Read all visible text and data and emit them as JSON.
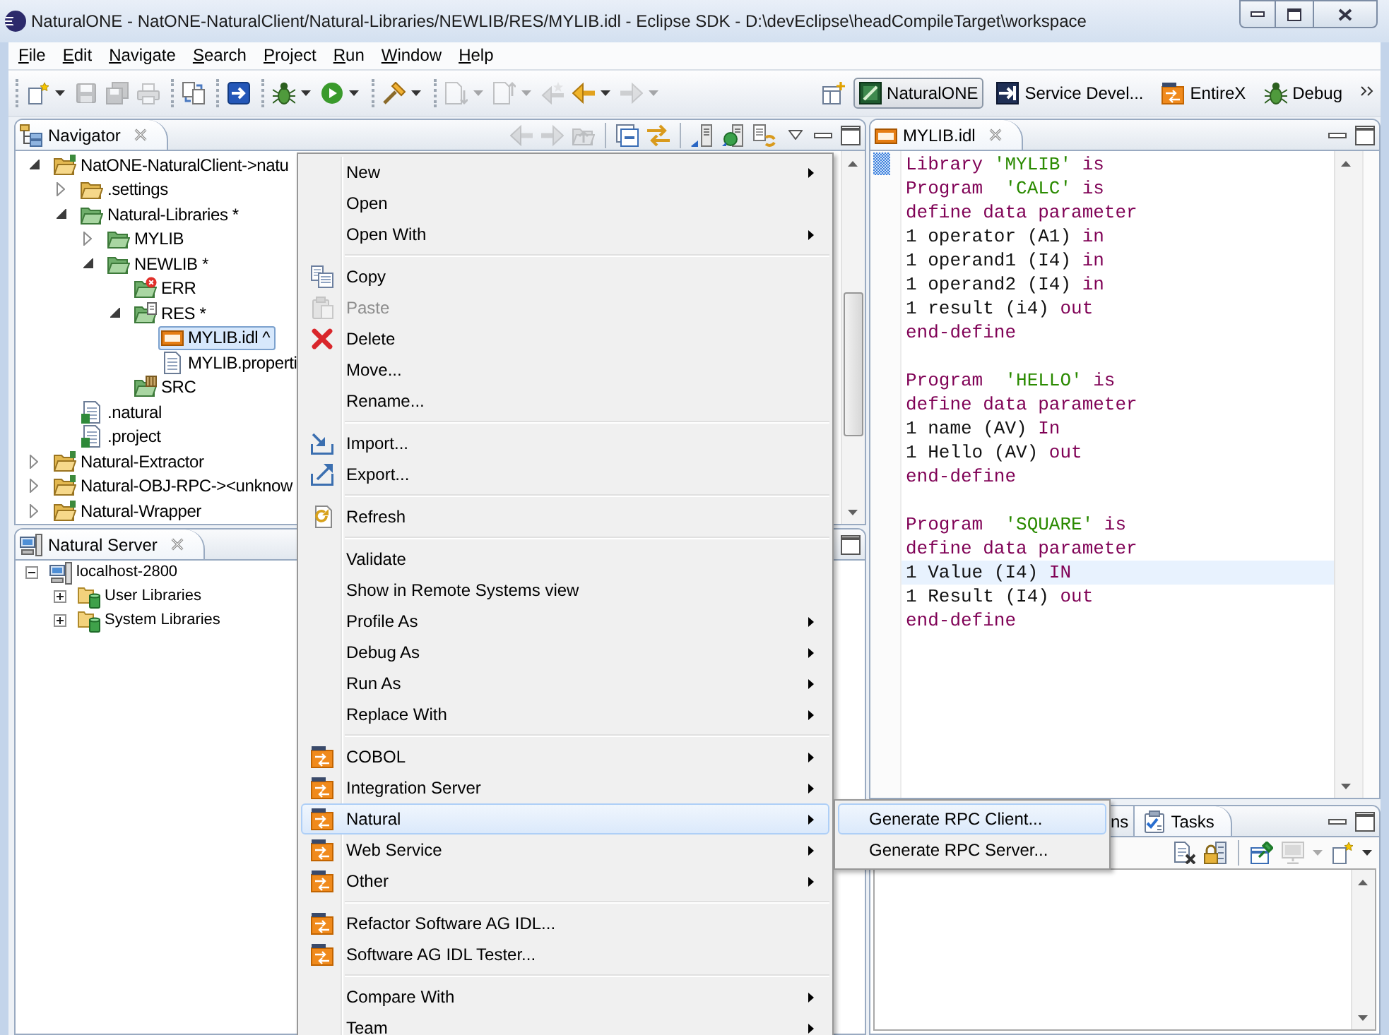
{
  "window": {
    "title": "NaturalONE - NatONE-NaturalClient/Natural-Libraries/NEWLIB/RES/MYLIB.idl - Eclipse SDK - D:\\devEclipse\\headCompileTarget\\workspace"
  },
  "menu_bar": [
    "File",
    "Edit",
    "Navigate",
    "Search",
    "Project",
    "Run",
    "Window",
    "Help"
  ],
  "toolbar": [
    [
      {
        "kind": "new",
        "dropdown": true,
        "disabled": false
      },
      {
        "kind": "save",
        "dropdown": false,
        "disabled": true
      },
      {
        "kind": "saveall",
        "dropdown": false,
        "disabled": true
      },
      {
        "kind": "print",
        "dropdown": false,
        "disabled": true
      }
    ],
    [
      {
        "kind": "sync",
        "dropdown": false,
        "disabled": false
      }
    ],
    [
      {
        "kind": "launch",
        "dropdown": false,
        "disabled": false
      }
    ],
    [
      {
        "kind": "debug",
        "dropdown": true,
        "disabled": false
      },
      {
        "kind": "run",
        "dropdown": true,
        "disabled": false
      }
    ],
    [
      {
        "kind": "tools",
        "dropdown": true,
        "disabled": false
      }
    ],
    [
      {
        "kind": "next",
        "dropdown": true,
        "disabled": true
      },
      {
        "kind": "prev",
        "dropdown": true,
        "disabled": true
      },
      {
        "kind": "lastedit",
        "dropdown": false,
        "disabled": true
      },
      {
        "kind": "back",
        "dropdown": true,
        "disabled": false
      },
      {
        "kind": "forward",
        "dropdown": true,
        "disabled": true
      }
    ]
  ],
  "perspectives": [
    {
      "kind": "natural",
      "label": "NaturalONE",
      "selected": true
    },
    {
      "kind": "service",
      "label": "Service Devel...",
      "selected": false
    },
    {
      "kind": "entirex",
      "label": "EntireX",
      "selected": false
    },
    {
      "kind": "debug",
      "label": "Debug",
      "selected": false
    }
  ],
  "navigator": {
    "title": "Navigator",
    "toolbar": [
      {
        "kind": "back",
        "disabled": true
      },
      {
        "kind": "forward",
        "disabled": true
      },
      {
        "kind": "up",
        "disabled": true
      },
      {
        "kind": "separator"
      },
      {
        "kind": "collapse",
        "disabled": false
      },
      {
        "kind": "link",
        "disabled": false
      },
      {
        "kind": "separator"
      },
      {
        "kind": "upload",
        "disabled": false
      },
      {
        "kind": "download",
        "disabled": false
      },
      {
        "kind": "syncserver",
        "disabled": false
      }
    ],
    "tree": [
      {
        "label": "NatONE-NaturalClient->natu",
        "kind": "project",
        "expanded": true,
        "selected": false,
        "children": [
          {
            "label": ".settings",
            "kind": "folder",
            "expanded": false,
            "selected": false
          },
          {
            "label": "Natural-Libraries *",
            "kind": "libfolder",
            "expanded": true,
            "selected": false,
            "children": [
              {
                "label": "MYLIB",
                "kind": "libfolder",
                "expanded": false,
                "selected": false
              },
              {
                "label": "NEWLIB *",
                "kind": "libfolder",
                "expanded": true,
                "selected": false,
                "children": [
                  {
                    "label": "ERR",
                    "kind": "errfolder",
                    "selected": false
                  },
                  {
                    "label": "RES *",
                    "kind": "resfolder",
                    "expanded": true,
                    "selected": false,
                    "children": [
                      {
                        "label": "MYLIB.idl ^",
                        "kind": "idl",
                        "selected": true
                      },
                      {
                        "label": "MYLIB.properti",
                        "kind": "textfile",
                        "selected": false
                      }
                    ]
                  },
                  {
                    "label": "SRC",
                    "kind": "srcfolder",
                    "selected": false
                  }
                ]
              }
            ]
          },
          {
            "label": ".natural",
            "kind": "natfile",
            "selected": false
          },
          {
            "label": ".project",
            "kind": "natfile",
            "selected": false
          }
        ]
      },
      {
        "label": "Natural-Extractor",
        "kind": "project",
        "expanded": false,
        "selected": false
      },
      {
        "label": "Natural-OBJ-RPC-><unknow",
        "kind": "project",
        "expanded": false,
        "selected": false
      },
      {
        "label": "Natural-Wrapper",
        "kind": "project",
        "expanded": false,
        "selected": false
      }
    ]
  },
  "natural_server": {
    "title": "Natural Server",
    "tree": [
      {
        "label": "localhost-2800",
        "kind": "server",
        "expanded": true,
        "selected": false,
        "children": [
          {
            "label": "User Libraries",
            "kind": "libgroup",
            "expanded": false,
            "selected": false
          },
          {
            "label": "System Libraries",
            "kind": "libgroup",
            "expanded": false,
            "selected": false
          }
        ]
      }
    ]
  },
  "editor": {
    "tab": "MYLIB.idl",
    "lines": [
      {
        "current": false,
        "tokens": [
          {
            "kind": "kw",
            "text": "Library"
          },
          {
            "kind": "str",
            "text": " 'MYLIB'"
          },
          {
            "kind": "kw",
            "text": " is"
          }
        ]
      },
      {
        "current": false,
        "tokens": [
          {
            "kind": "kw",
            "text": "Program"
          },
          {
            "kind": "str",
            "text": "  'CALC'"
          },
          {
            "kind": "kw",
            "text": " is"
          }
        ]
      },
      {
        "current": false,
        "tokens": [
          {
            "kind": "kw",
            "text": "define data parameter"
          }
        ]
      },
      {
        "current": false,
        "tokens": [
          {
            "kind": "txt",
            "text": "1 operator (A1)"
          },
          {
            "kind": "kw",
            "text": " in"
          }
        ]
      },
      {
        "current": false,
        "tokens": [
          {
            "kind": "txt",
            "text": "1 operand1 (I4)"
          },
          {
            "kind": "kw",
            "text": " in"
          }
        ]
      },
      {
        "current": false,
        "tokens": [
          {
            "kind": "txt",
            "text": "1 operand2 (I4)"
          },
          {
            "kind": "kw",
            "text": " in"
          }
        ]
      },
      {
        "current": false,
        "tokens": [
          {
            "kind": "txt",
            "text": "1 result (i4)"
          },
          {
            "kind": "kw",
            "text": " out"
          }
        ]
      },
      {
        "current": false,
        "tokens": [
          {
            "kind": "kw",
            "text": "end-define"
          }
        ]
      },
      {
        "current": false
      },
      {
        "current": false,
        "tokens": [
          {
            "kind": "kw",
            "text": "Program"
          },
          {
            "kind": "str",
            "text": "  'HELLO'"
          },
          {
            "kind": "kw",
            "text": " is"
          }
        ]
      },
      {
        "current": false,
        "tokens": [
          {
            "kind": "kw",
            "text": "define data parameter"
          }
        ]
      },
      {
        "current": false,
        "tokens": [
          {
            "kind": "txt",
            "text": "1 name (AV)"
          },
          {
            "kind": "kw",
            "text": " In"
          }
        ]
      },
      {
        "current": false,
        "tokens": [
          {
            "kind": "txt",
            "text": "1 Hello (AV)"
          },
          {
            "kind": "kw",
            "text": " out"
          }
        ]
      },
      {
        "current": false,
        "tokens": [
          {
            "kind": "kw",
            "text": "end-define"
          }
        ]
      },
      {
        "current": false
      },
      {
        "current": false,
        "tokens": [
          {
            "kind": "kw",
            "text": "Program"
          },
          {
            "kind": "str",
            "text": "  'SQUARE'"
          },
          {
            "kind": "kw",
            "text": " is"
          }
        ]
      },
      {
        "current": false,
        "tokens": [
          {
            "kind": "kw",
            "text": "define data parameter"
          }
        ]
      },
      {
        "current": true,
        "tokens": [
          {
            "kind": "txt",
            "text": "1 Value (I4)"
          },
          {
            "kind": "kw",
            "text": " IN"
          }
        ]
      },
      {
        "current": false,
        "tokens": [
          {
            "kind": "txt",
            "text": "1 Result (I4)"
          },
          {
            "kind": "kw",
            "text": " out"
          }
        ]
      },
      {
        "current": false,
        "tokens": [
          {
            "kind": "kw",
            "text": "end-define"
          }
        ]
      }
    ]
  },
  "bottom_panel": {
    "tabs": [
      {
        "kind": "plain",
        "label": "ns",
        "selected": false
      },
      {
        "kind": "tasks",
        "label": "Tasks",
        "selected": true
      }
    ],
    "toolbar": [
      {
        "kind": "clear",
        "dropdown": false,
        "disabled": false
      },
      {
        "kind": "lock",
        "dropdown": false,
        "disabled": false
      },
      {
        "kind": "separator"
      },
      {
        "kind": "pin",
        "dropdown": false,
        "disabled": false
      },
      {
        "kind": "screen",
        "dropdown": true,
        "disabled": true
      },
      {
        "kind": "new",
        "dropdown": true,
        "disabled": false
      }
    ]
  },
  "context_menu": {
    "items": [
      {
        "kind": "plain",
        "label": "New",
        "submenu": true,
        "disabled": false,
        "highlighted": false
      },
      {
        "kind": "plain",
        "label": "Open",
        "submenu": false,
        "disabled": false,
        "highlighted": false
      },
      {
        "kind": "plain",
        "label": "Open With",
        "submenu": true,
        "disabled": false,
        "highlighted": false
      },
      {
        "kind": "separator"
      },
      {
        "kind": "copy",
        "label": "Copy",
        "submenu": false,
        "disabled": false,
        "highlighted": false
      },
      {
        "kind": "paste",
        "label": "Paste",
        "submenu": false,
        "disabled": true,
        "highlighted": false
      },
      {
        "kind": "delete",
        "label": "Delete",
        "submenu": false,
        "disabled": false,
        "highlighted": false
      },
      {
        "kind": "plain",
        "label": "Move...",
        "submenu": false,
        "disabled": false,
        "highlighted": false
      },
      {
        "kind": "plain",
        "label": "Rename...",
        "submenu": false,
        "disabled": false,
        "highlighted": false
      },
      {
        "kind": "separator"
      },
      {
        "kind": "import",
        "label": "Import...",
        "submenu": false,
        "disabled": false,
        "highlighted": false
      },
      {
        "kind": "export",
        "label": "Export...",
        "submenu": false,
        "disabled": false,
        "highlighted": false
      },
      {
        "kind": "separator"
      },
      {
        "kind": "refresh",
        "label": "Refresh",
        "submenu": false,
        "disabled": false,
        "highlighted": false
      },
      {
        "kind": "separator"
      },
      {
        "kind": "plain",
        "label": "Validate",
        "submenu": false,
        "disabled": false,
        "highlighted": false
      },
      {
        "kind": "plain",
        "label": "Show in Remote Systems view",
        "submenu": false,
        "disabled": false,
        "highlighted": false
      },
      {
        "kind": "plain",
        "label": "Profile As",
        "submenu": true,
        "disabled": false,
        "highlighted": false
      },
      {
        "kind": "plain",
        "label": "Debug As",
        "submenu": true,
        "disabled": false,
        "highlighted": false
      },
      {
        "kind": "plain",
        "label": "Run As",
        "submenu": true,
        "disabled": false,
        "highlighted": false
      },
      {
        "kind": "plain",
        "label": "Replace With",
        "submenu": true,
        "disabled": false,
        "highlighted": false
      },
      {
        "kind": "separator"
      },
      {
        "kind": "sag",
        "label": "COBOL",
        "submenu": true,
        "disabled": false,
        "highlighted": false
      },
      {
        "kind": "sag",
        "label": "Integration Server",
        "submenu": true,
        "disabled": false,
        "highlighted": false
      },
      {
        "kind": "sag",
        "label": "Natural",
        "submenu": true,
        "disabled": false,
        "highlighted": true
      },
      {
        "kind": "sag",
        "label": "Web Service",
        "submenu": true,
        "disabled": false,
        "highlighted": false
      },
      {
        "kind": "sag",
        "label": "Other",
        "submenu": true,
        "disabled": false,
        "highlighted": false
      },
      {
        "kind": "separator"
      },
      {
        "kind": "sag",
        "label": "Refactor Software AG IDL...",
        "submenu": false,
        "disabled": false,
        "highlighted": false
      },
      {
        "kind": "sag",
        "label": "Software AG IDL Tester...",
        "submenu": false,
        "disabled": false,
        "highlighted": false
      },
      {
        "kind": "separator"
      },
      {
        "kind": "plain",
        "label": "Compare With",
        "submenu": true,
        "disabled": false,
        "highlighted": false
      },
      {
        "kind": "plain",
        "label": "Team",
        "submenu": true,
        "disabled": false,
        "highlighted": false
      }
    ]
  },
  "submenu": {
    "items": [
      {
        "label": "Generate RPC Client...",
        "highlighted": true
      },
      {
        "label": "Generate RPC Server...",
        "highlighted": false
      }
    ]
  }
}
